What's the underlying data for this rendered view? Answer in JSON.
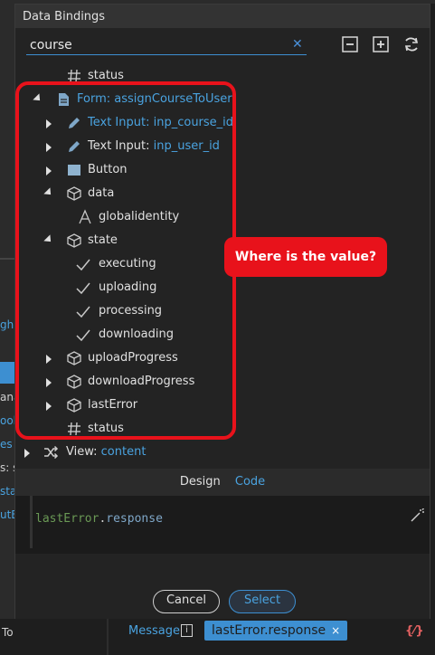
{
  "dialog": {
    "title": "Data Bindings",
    "search_value": "course",
    "clear_symbol": "✕"
  },
  "tree": {
    "top_partial_label": "status",
    "form": {
      "label": "Form: assignCourseToUser"
    },
    "items": [
      {
        "prefix": "Text Input: ",
        "name": "inp_course_id"
      },
      {
        "prefix": "Text Input: ",
        "name": "inp_user_id"
      },
      {
        "label": "Button"
      },
      {
        "label": "data"
      },
      {
        "label": "globalidentity"
      },
      {
        "label": "state"
      },
      {
        "label": "executing"
      },
      {
        "label": "uploading"
      },
      {
        "label": "processing"
      },
      {
        "label": "downloading"
      },
      {
        "label": "uploadProgress"
      },
      {
        "label": "downloadProgress"
      },
      {
        "label": "lastError"
      },
      {
        "label": "status"
      }
    ],
    "view": {
      "prefix": "View: ",
      "name": "content"
    }
  },
  "callout": {
    "text": "Where is the value?",
    "color": "#e8121b"
  },
  "tabs": {
    "design": "Design",
    "code": "Code"
  },
  "editor": {
    "obj": "lastError",
    "dot": ".",
    "prop": "response"
  },
  "footer": {
    "cancel": "Cancel",
    "select": "Select"
  },
  "background": {
    "fragments": [
      "gh",
      "ana",
      "ool",
      "es",
      "s: su",
      "star",
      "utE"
    ],
    "to_label": "To",
    "message_label": "Message",
    "info_symbol": "i",
    "chip_value": "lastError.response",
    "chip_remove": "×",
    "dynamic_symbol": "{⁄}"
  },
  "colors": {
    "accent": "#4aa3e0",
    "highlight": "#e8121b"
  }
}
